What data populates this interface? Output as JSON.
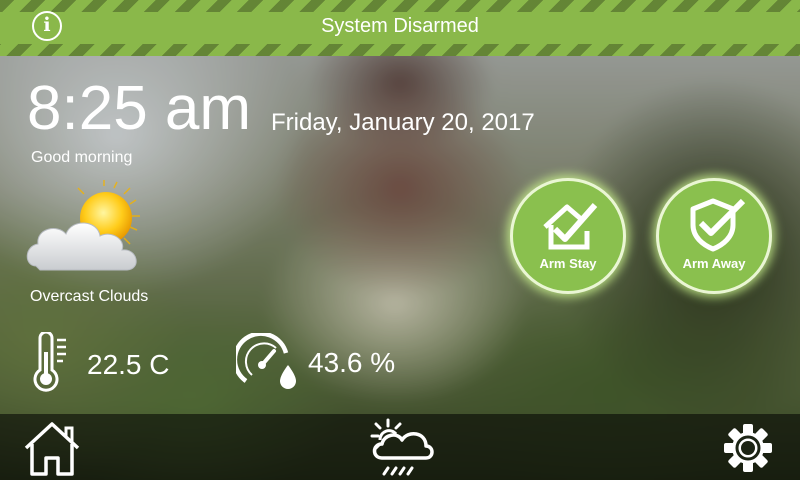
{
  "status_bar": {
    "title": "System Disarmed",
    "info_icon": "info-icon",
    "accent_color": "#8ab84a"
  },
  "clock": {
    "time": "8:25 am",
    "date": "Friday, January 20, 2017",
    "greeting": "Good morning"
  },
  "weather": {
    "icon": "partly-cloudy-sun-icon",
    "condition": "Overcast Clouds"
  },
  "sensors": {
    "temperature": {
      "icon": "thermometer-icon",
      "value": "22.5 C"
    },
    "humidity": {
      "icon": "humidity-gauge-icon",
      "value": "43.6 %"
    }
  },
  "arm_buttons": {
    "stay": {
      "label": "Arm Stay",
      "icon": "house-check-icon"
    },
    "away": {
      "label": "Arm Away",
      "icon": "shield-check-icon"
    }
  },
  "bottom_nav": {
    "home": "home-icon",
    "weather": "weather-icon",
    "settings": "gear-icon"
  }
}
